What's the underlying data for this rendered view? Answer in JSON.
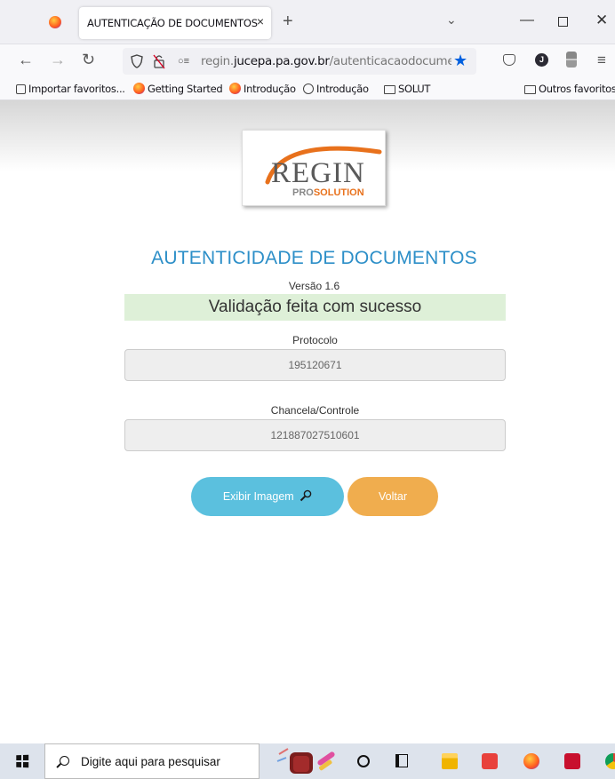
{
  "browser": {
    "tab_title": "AUTENTICAÇÃO DE DOCUMENTOS",
    "tab_close": "×",
    "new_tab": "+",
    "url_plain": "regin.",
    "url_domain": "jucepa.pa.gov.br",
    "url_path": "/autenticacaodocumento"
  },
  "bookmarks": [
    {
      "label": "Importar favoritos...",
      "icon": "import-icon"
    },
    {
      "label": "Getting Started",
      "icon": "firefox-icon"
    },
    {
      "label": "Introdução",
      "icon": "firefox-icon"
    },
    {
      "label": "Introdução",
      "icon": "globe-icon"
    },
    {
      "label": "SOLUT",
      "icon": "folder-icon"
    },
    {
      "label": "Outros favoritos",
      "icon": "folder-icon"
    }
  ],
  "logo": {
    "name": "REGIN",
    "pro": "PRO",
    "solution": "SOLUTION"
  },
  "page": {
    "heading": "AUTENTICIDADE DE DOCUMENTOS",
    "version": "Versão 1.6",
    "success_message": "Validação feita com sucesso",
    "protocolo_label": "Protocolo",
    "protocolo_value": "195120671",
    "chancela_label": "Chancela/Controle",
    "chancela_value": "121887027510601",
    "btn_image": "Exibir Imagem",
    "btn_back": "Voltar"
  },
  "colors": {
    "heading": "#2d8fc8",
    "success_bg": "#def0d8",
    "btn_image": "#5bc0de",
    "btn_back": "#f0ad4e",
    "logo_orange": "#e8711c"
  },
  "taskbar": {
    "search_placeholder": "Digite aqui para pesquisar"
  }
}
